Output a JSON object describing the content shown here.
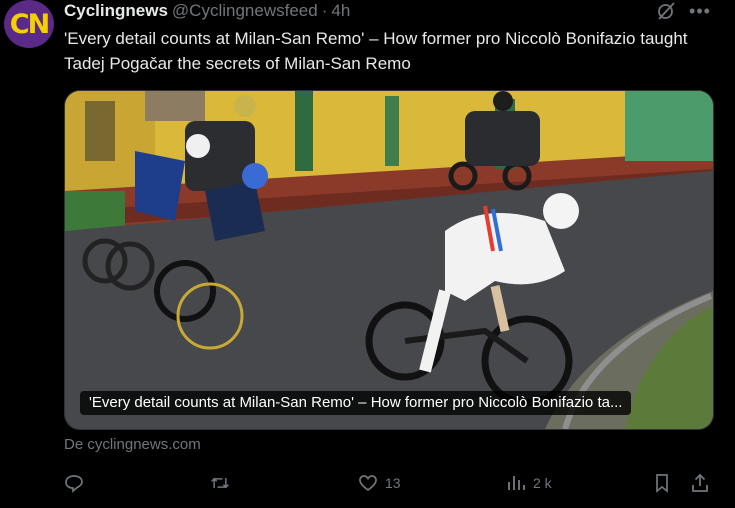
{
  "post": {
    "avatar_text": "CN",
    "author_name": "Cyclingnews",
    "handle": "@Cyclingnewsfeed",
    "separator": "·",
    "time": "4h",
    "more_icon": "more-icon",
    "text": "'Every detail counts at Milan-San Remo' – How former pro Niccolò Bonifazio taught Tadej Pogačar the secrets of Milan-San Remo"
  },
  "card": {
    "caption": "'Every detail counts at Milan-San Remo' – How former pro Niccolò Bonifazio ta...",
    "source": "De cyclingnews.com"
  },
  "actions": {
    "reply": {
      "icon": "reply-icon",
      "count": ""
    },
    "repost": {
      "icon": "repost-icon",
      "count": ""
    },
    "like": {
      "icon": "heart-icon",
      "count": "13"
    },
    "views": {
      "icon": "views-icon",
      "count": "2 k"
    },
    "bookmark": {
      "icon": "bookmark-icon"
    },
    "share": {
      "icon": "share-icon"
    }
  },
  "colors": {
    "background": "#000000",
    "text": "#e7e9ea",
    "muted": "#71767b",
    "avatar_bg": "#5b2a86",
    "avatar_fg": "#f5d000"
  }
}
